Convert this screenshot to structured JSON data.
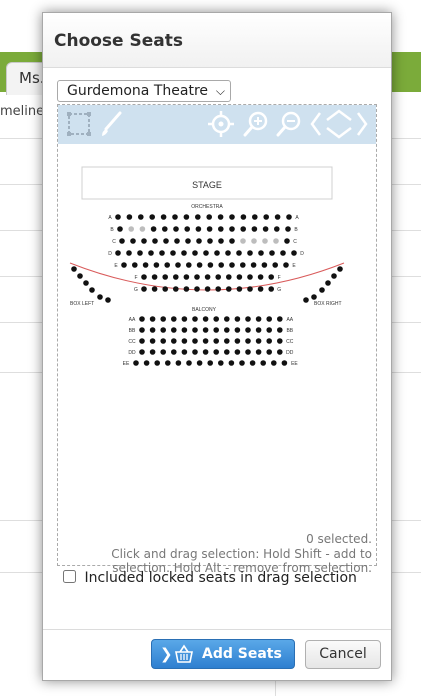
{
  "background": {
    "tab_label": "Ms.",
    "text": "meline"
  },
  "dialog": {
    "title": "Choose Seats",
    "venue": "Gurdemona Theatre",
    "status_selected": "0 selected.",
    "help_line1": "Click and drag selection: Hold Shift - add to",
    "help_line2": "selection. Hold Alt - remove from selection.",
    "locked_label": "Included locked seats in drag selection",
    "add_button": "Add Seats",
    "cancel_button": "Cancel"
  },
  "toolbar": {
    "icons": [
      "select-area-icon",
      "brush-icon",
      "recenter-icon",
      "zoom-in-icon",
      "zoom-out-icon",
      "pan-arrows-icon"
    ]
  },
  "seat_map": {
    "stage": "STAGE",
    "orchestra": "ORCHESTRA",
    "balcony": "BALCONY",
    "box_left": "BOX LEFT",
    "box_right": "BOX RIGHT",
    "orchestra_rows": [
      "A",
      "B",
      "C",
      "D",
      "E",
      "F",
      "G"
    ],
    "balcony_rows": [
      "AA",
      "BB",
      "CC",
      "DD",
      "EE"
    ],
    "colors": {
      "seat": "#111111",
      "unavailable": "#bdbdbd",
      "curve": "#d95b5b",
      "toolbar": "#cfe1ef"
    }
  }
}
